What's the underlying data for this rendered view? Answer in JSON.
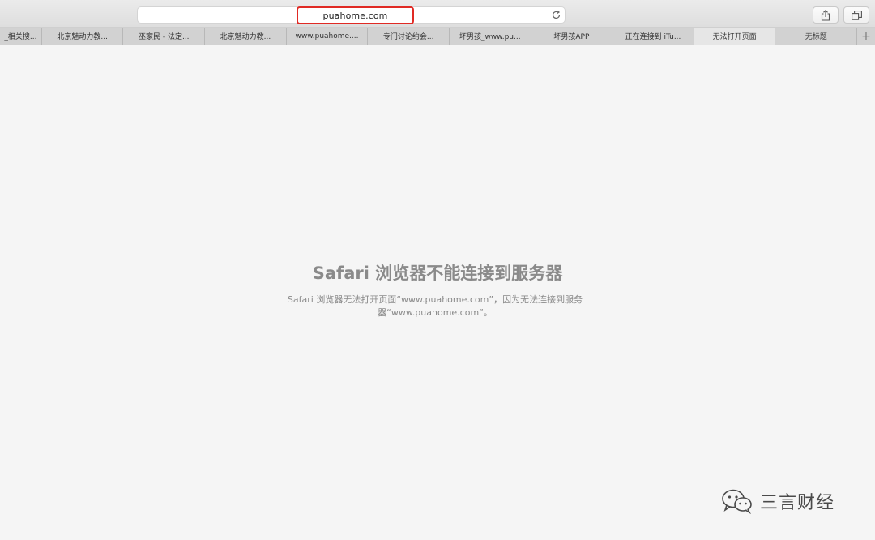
{
  "browser": {
    "address": "puahome.com",
    "icons": {
      "reload": "reload-icon",
      "share": "share-icon",
      "tabs": "tab-overview-icon",
      "new_tab": "plus-icon"
    }
  },
  "tabs": [
    {
      "label": "_相关搜...",
      "active": false
    },
    {
      "label": "北京魅动力教...",
      "active": false
    },
    {
      "label": "巫家民 - 法定...",
      "active": false
    },
    {
      "label": "北京魅动力教...",
      "active": false
    },
    {
      "label": "www.puahome....",
      "active": false
    },
    {
      "label": "专门讨论约会...",
      "active": false
    },
    {
      "label": "坏男孩_www.pu...",
      "active": false
    },
    {
      "label": "坏男孩APP",
      "active": false
    },
    {
      "label": "正在连接到 iTu...",
      "active": false
    },
    {
      "label": "无法打开页面",
      "active": true
    },
    {
      "label": "无标题",
      "active": false
    }
  ],
  "new_tab_label": "+",
  "error": {
    "title": "Safari 浏览器不能连接到服务器",
    "message": "Safari 浏览器无法打开页面“www.puahome.com”，因为无法连接到服务器“www.puahome.com”。"
  },
  "watermark": {
    "text": "三言财经",
    "icon": "wechat-icon"
  },
  "colors": {
    "highlight_border": "#e02a24",
    "error_text": "#8a8a8a"
  }
}
